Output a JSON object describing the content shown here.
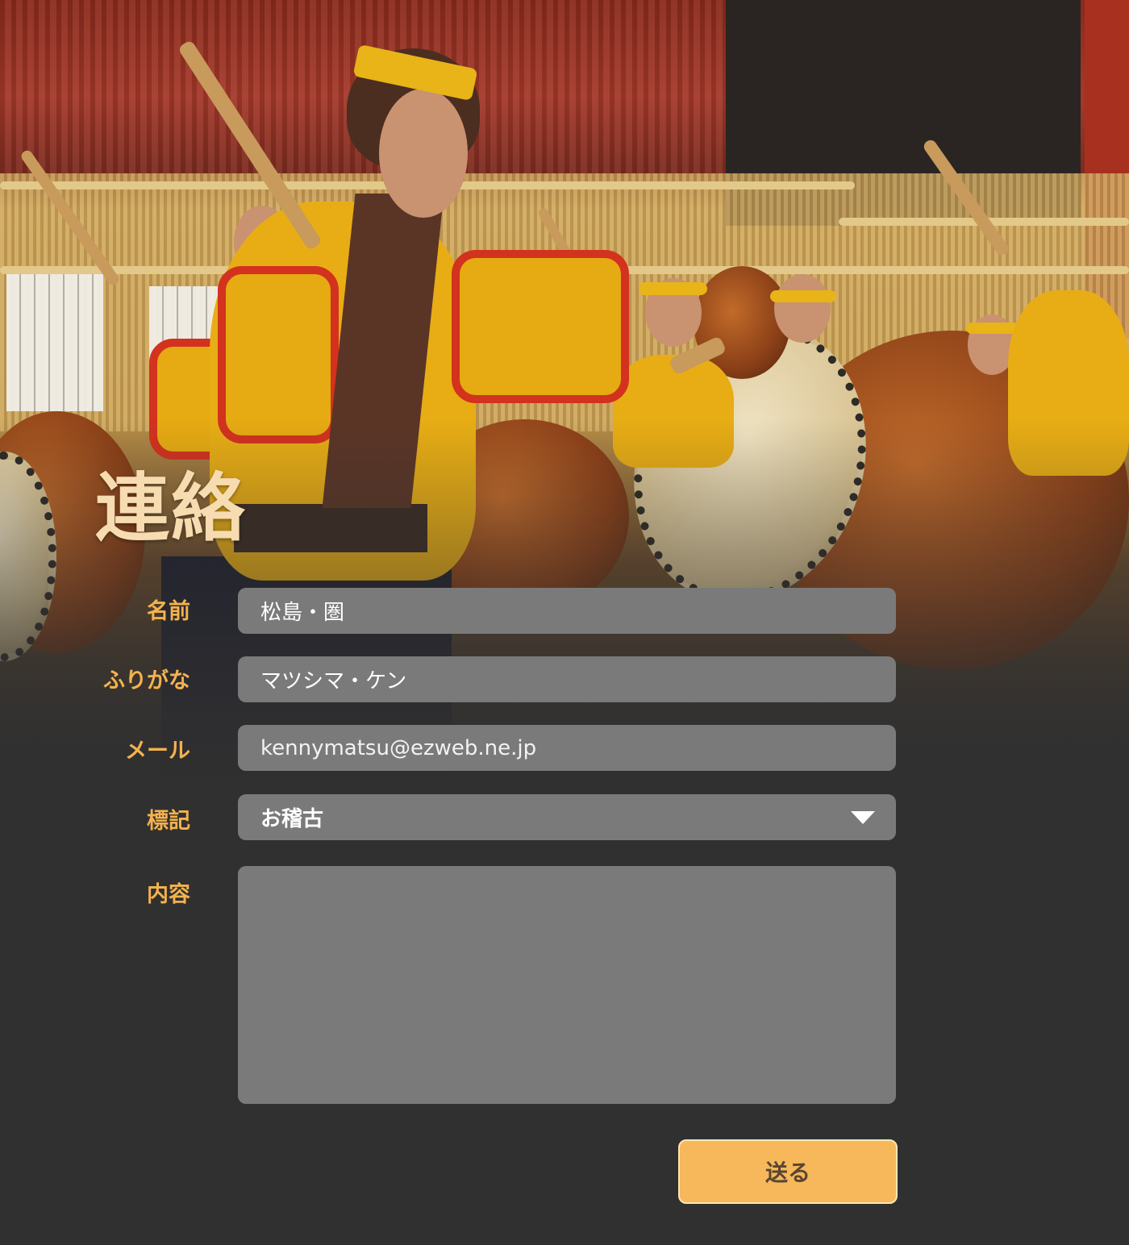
{
  "page": {
    "title": "連絡"
  },
  "form": {
    "name": {
      "label": "名前",
      "value": "松島・圏"
    },
    "furigana": {
      "label": "ふりがな",
      "value": "マツシマ・ケン"
    },
    "email": {
      "label": "メール",
      "value": "kennymatsu@ezweb.ne.jp"
    },
    "subject": {
      "label": "標記",
      "selected": "お稽古"
    },
    "message": {
      "label": "内容",
      "value": ""
    },
    "submit_label": "送る"
  },
  "colors": {
    "background": "#303030",
    "label": "#f4b24d",
    "title": "#f6dcb0",
    "field": "#7a7a7a",
    "button": "#f6b85a"
  },
  "icons": {
    "select_caret": "caret-down-icon"
  }
}
